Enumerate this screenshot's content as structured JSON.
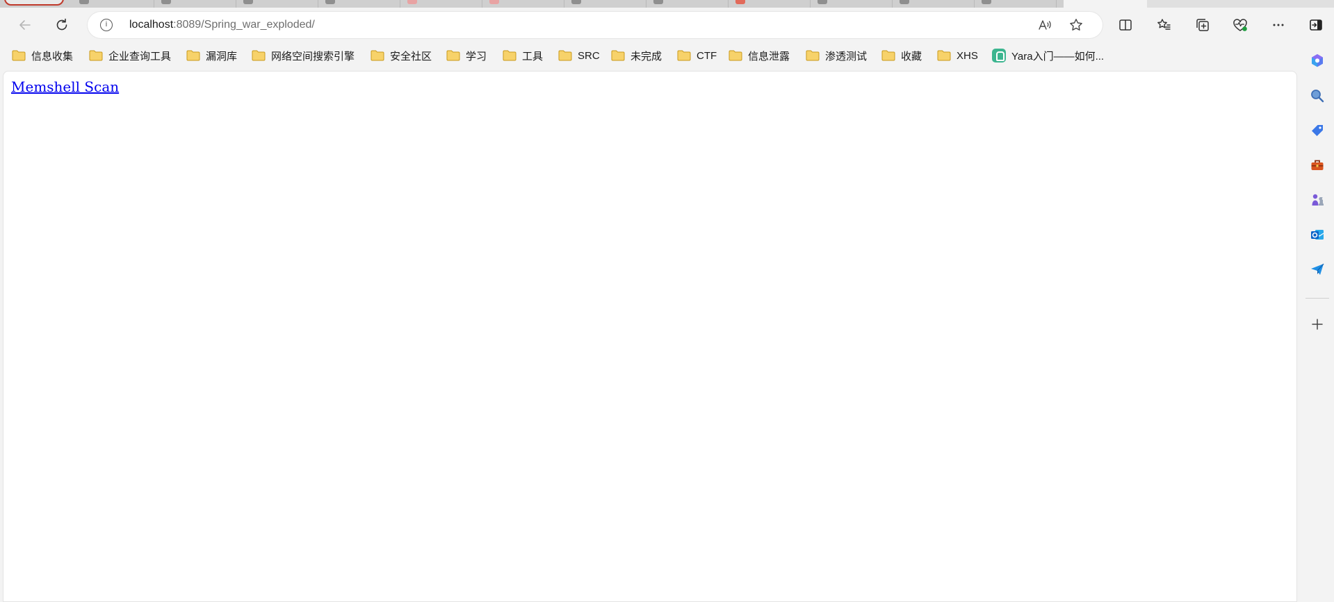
{
  "toolbar": {
    "url_host": "localhost",
    "url_rest": ":8089/Spring_war_exploded/"
  },
  "bookmarks": [
    {
      "label": "信息收集"
    },
    {
      "label": "企业查询工具"
    },
    {
      "label": "漏洞库"
    },
    {
      "label": "网络空间搜索引擎"
    },
    {
      "label": "安全社区"
    },
    {
      "label": "学习"
    },
    {
      "label": "工具"
    },
    {
      "label": "SRC"
    },
    {
      "label": "未完成"
    },
    {
      "label": "CTF"
    },
    {
      "label": "信息泄露"
    },
    {
      "label": "渗透测试"
    },
    {
      "label": "收藏"
    },
    {
      "label": "XHS"
    },
    {
      "label": "Yara入门——如何..."
    }
  ],
  "page": {
    "link_text": "Memshell Scan"
  },
  "colors": {
    "folder_fill": "#f7d26a",
    "folder_stroke": "#c99a1c",
    "link": "#0000ee"
  }
}
